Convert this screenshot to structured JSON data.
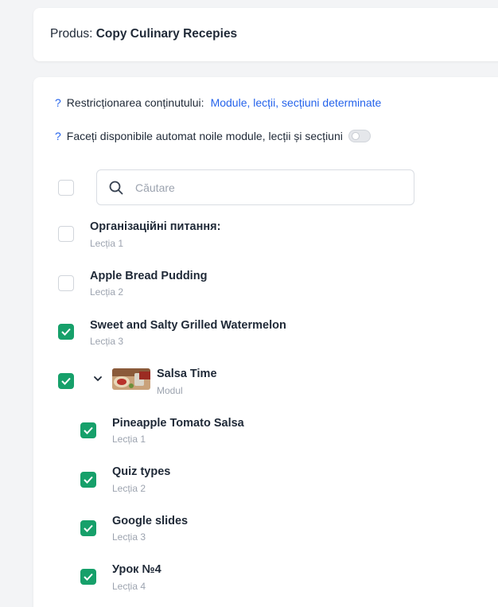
{
  "product": {
    "label": "Produs:",
    "name": "Copy Culinary Recepies"
  },
  "restriction": {
    "help": "?",
    "label": "Restricționarea conținutului:",
    "value": "Module, lecții, secțiuni determinate"
  },
  "auto_available": {
    "help": "?",
    "label": "Faceți disponibile automat noile module, lecții și secțiuni",
    "enabled": false
  },
  "search": {
    "placeholder": "Căutare",
    "value": ""
  },
  "items": [
    {
      "title": "Організаційні питання:",
      "subtitle": "Lecția 1",
      "checked": false
    },
    {
      "title": "Apple Bread Pudding",
      "subtitle": "Lecția 2",
      "checked": false
    },
    {
      "title": "Sweet and Salty Grilled Watermelon",
      "subtitle": "Lecția 3",
      "checked": true
    },
    {
      "title": "Salsa Time",
      "subtitle": "Modul",
      "checked": true,
      "expanded": true
    }
  ],
  "module_lessons": [
    {
      "title": "Pineapple Tomato Salsa",
      "subtitle": "Lecția 1",
      "checked": true
    },
    {
      "title": "Quiz types",
      "subtitle": "Lecția 2",
      "checked": true
    },
    {
      "title": "Google slides",
      "subtitle": "Lecția 3",
      "checked": true
    },
    {
      "title": "Урок №4",
      "subtitle": "Lecția 4",
      "checked": true
    }
  ],
  "colors": {
    "accent": "#2563eb",
    "checked": "#16a06a",
    "background": "#f3f4f6"
  }
}
